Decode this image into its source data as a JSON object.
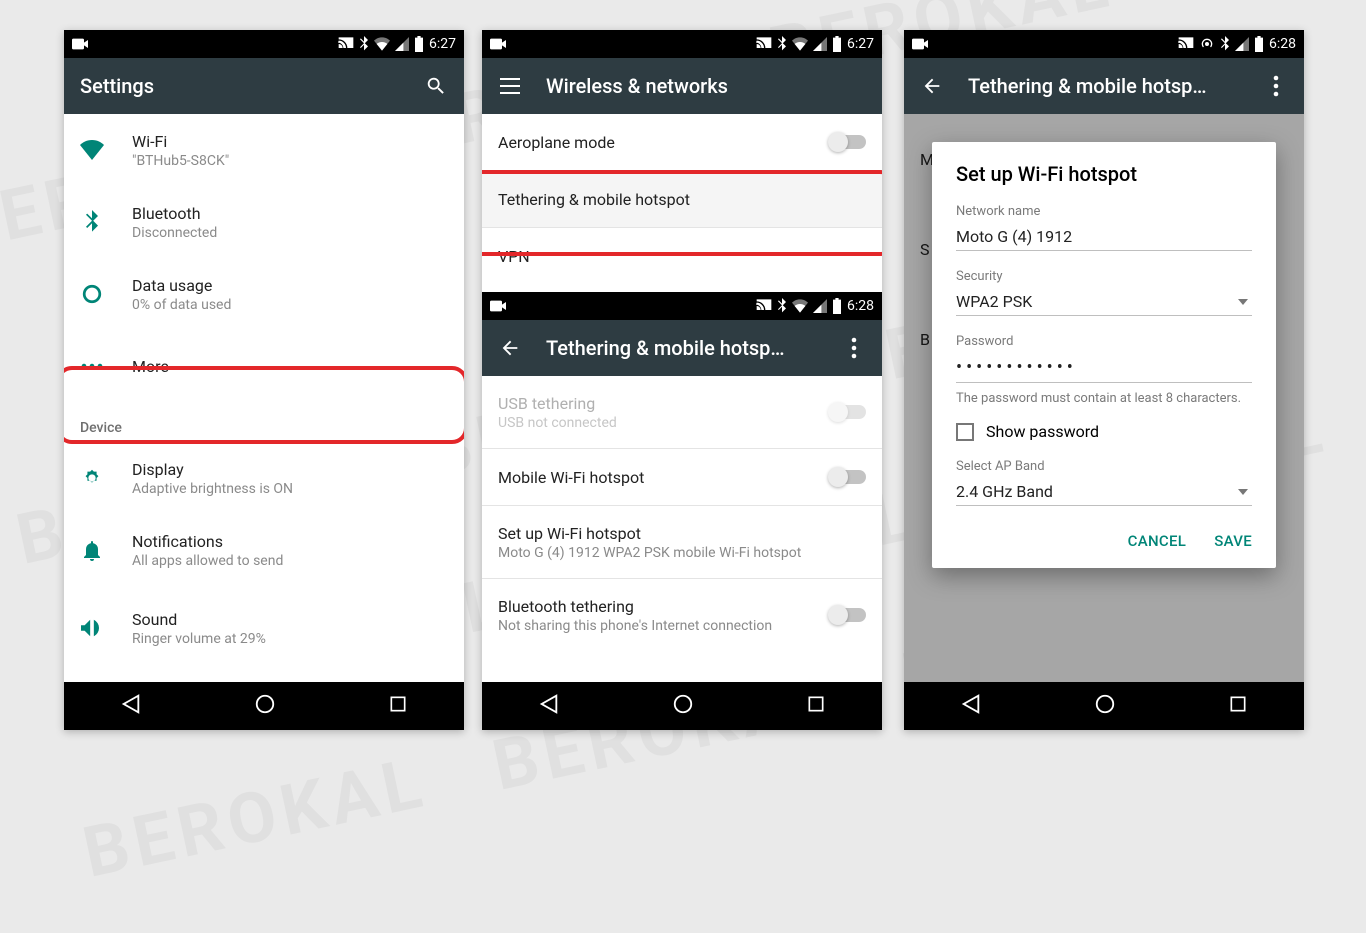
{
  "watermark": "BEROKAL   BEROKAL   BEROKAL\n     BEROKAL   BEROKAL   BEROKAL\nBEROKAL   BEROKAL   BEROKAL\n     BEROKAL   BEROKAL   BEROKAL\nBEROKAL   BEROKAL   BEROKAL",
  "phone1": {
    "status_time": "6:27",
    "appbar_title": "Settings",
    "items": {
      "wifi": {
        "title": "Wi-Fi",
        "sub": "\"BTHub5-S8CK\""
      },
      "bluetooth": {
        "title": "Bluetooth",
        "sub": "Disconnected"
      },
      "data_usage": {
        "title": "Data usage",
        "sub": "0% of data used"
      },
      "more": {
        "title": "More"
      }
    },
    "section_device": "Device",
    "device_items": {
      "display": {
        "title": "Display",
        "sub": "Adaptive brightness is ON"
      },
      "notifications": {
        "title": "Notifications",
        "sub": "All apps allowed to send"
      },
      "sound": {
        "title": "Sound",
        "sub": "Ringer volume at 29%"
      }
    }
  },
  "phone2": {
    "status_time_upper": "6:27",
    "appbar_upper": "Wireless & networks",
    "upper_items": {
      "aeroplane": "Aeroplane mode",
      "tethering": "Tethering & mobile hotspot",
      "vpn": "VPN"
    },
    "status_time_lower": "6:28",
    "appbar_lower": "Tethering & mobile hotsp…",
    "lower_items": {
      "usb": {
        "title": "USB tethering",
        "sub": "USB not connected"
      },
      "mobile_hotspot": {
        "title": "Mobile Wi-Fi hotspot"
      },
      "setup": {
        "title": "Set up Wi-Fi hotspot",
        "sub": "Moto G (4) 1912 WPA2 PSK mobile Wi-Fi hotspot"
      },
      "bt_tether": {
        "title": "Bluetooth tethering",
        "sub": "Not sharing this phone's Internet connection"
      }
    }
  },
  "phone3": {
    "status_time": "6:28",
    "appbar_title": "Tethering & mobile hotsp…",
    "bg_items": {
      "m": "M",
      "s": "S",
      "b": "B"
    },
    "dialog": {
      "title": "Set up Wi-Fi hotspot",
      "network_label": "Network name",
      "network_value": "Moto G (4) 1912",
      "security_label": "Security",
      "security_value": "WPA2 PSK",
      "password_label": "Password",
      "password_value": "••••••••••••",
      "password_hint": "The password must contain at least 8 characters.",
      "show_password": "Show password",
      "band_label": "Select AP Band",
      "band_value": "2.4 GHz Band",
      "cancel": "CANCEL",
      "save": "SAVE"
    }
  }
}
